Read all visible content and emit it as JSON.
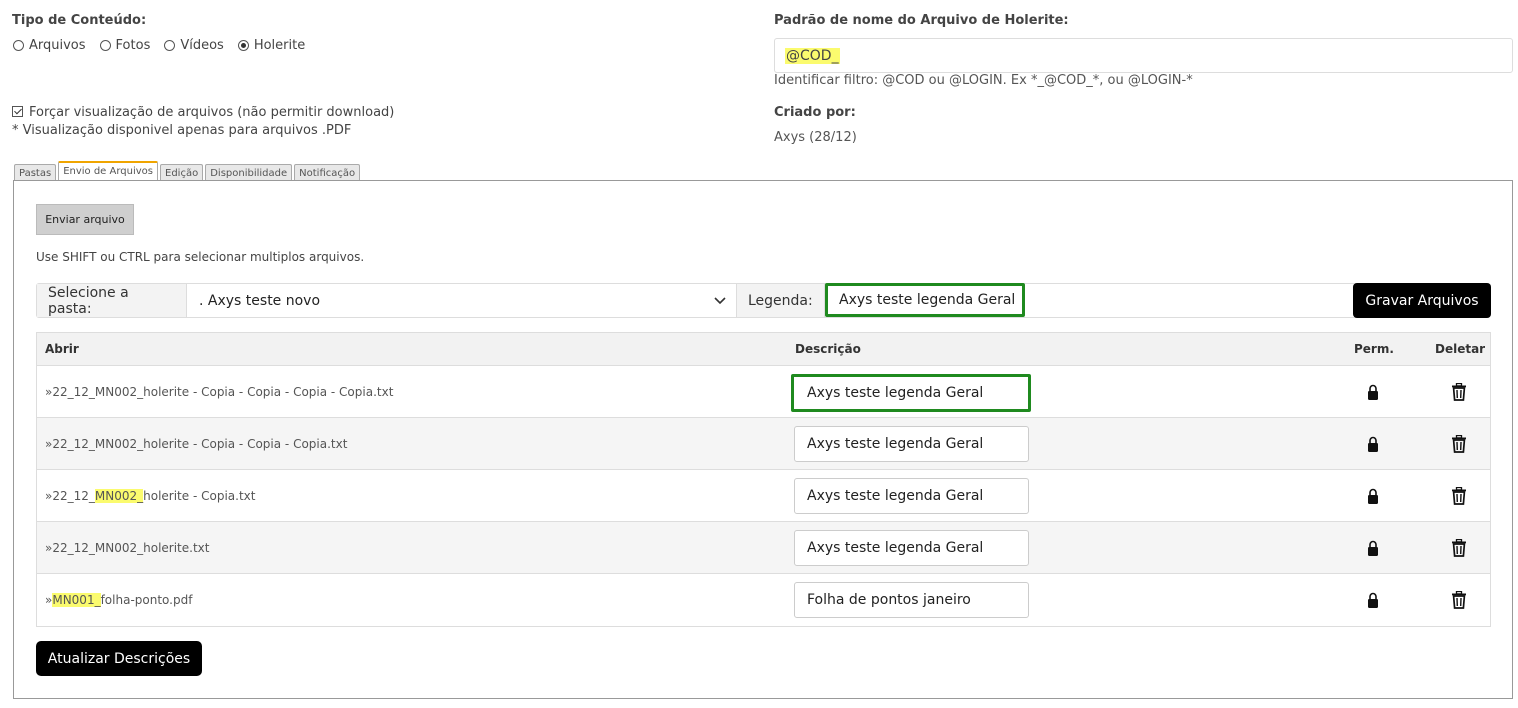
{
  "content_type": {
    "label": "Tipo de Conteúdo:",
    "options": [
      "Arquivos",
      "Fotos",
      "Vídeos",
      "Holerite"
    ],
    "selected": "Holerite"
  },
  "filename_pattern": {
    "label": "Padrão de nome do Arquivo de Holerite:",
    "value": "@COD_",
    "hint": "Identificar filtro: @COD ou @LOGIN. Ex *_@COD_*, ou @LOGIN-*"
  },
  "force_view": {
    "label": "Forçar visualização de arquivos (não permitir download)",
    "checked": true,
    "note": "* Visualização disponivel apenas para arquivos .PDF"
  },
  "created_by": {
    "label": "Criado por:",
    "value": "Axys (28/12)"
  },
  "tabs": [
    {
      "label": "Pastas",
      "active": false
    },
    {
      "label": "Envio de Arquivos",
      "active": true
    },
    {
      "label": "Edição",
      "active": false
    },
    {
      "label": "Disponibilidade",
      "active": false
    },
    {
      "label": "Notificação",
      "active": false
    }
  ],
  "upload": {
    "send_button": "Enviar arquivo",
    "hint": "Use SHIFT ou CTRL para selecionar multiplos arquivos.",
    "folder_label": "Selecione a pasta:",
    "folder_value": ". Axys teste novo",
    "caption_label": "Legenda:",
    "caption_value": "Axys teste legenda Geral",
    "save_button": "Gravar Arquivos"
  },
  "table": {
    "headers": {
      "open": "Abrir",
      "description": "Descrição",
      "perm": "Perm.",
      "delete": "Deletar"
    },
    "rows": [
      {
        "prefix": "» ",
        "pre": "22_12_MN002_holerite - Copia - Copia - Copia - Copia.txt",
        "highlight": "",
        "post": "",
        "description": "Axys teste legenda Geral"
      },
      {
        "prefix": "» ",
        "pre": "22_12_MN002_holerite - Copia - Copia - Copia.txt",
        "highlight": "",
        "post": "",
        "description": "Axys teste legenda Geral"
      },
      {
        "prefix": "» ",
        "pre": "22_12_",
        "highlight": "MN002_",
        "post": "holerite - Copia.txt",
        "description": "Axys teste legenda Geral"
      },
      {
        "prefix": "» ",
        "pre": "22_12_MN002_holerite.txt",
        "highlight": "",
        "post": "",
        "description": "Axys teste legenda Geral"
      },
      {
        "prefix": "» ",
        "pre": "",
        "highlight": "MN001_",
        "post": "folha-ponto.pdf",
        "description": "Folha de pontos janeiro"
      }
    ]
  },
  "update_button": "Atualizar Descrições",
  "icons": {
    "perm": "lock-icon",
    "delete": "trash-icon",
    "dropdown": "chevron-down-icon"
  },
  "colors": {
    "highlight": "#fbfb6e",
    "focus_border": "#1f8a1f",
    "active_tab": "#f0a500"
  }
}
